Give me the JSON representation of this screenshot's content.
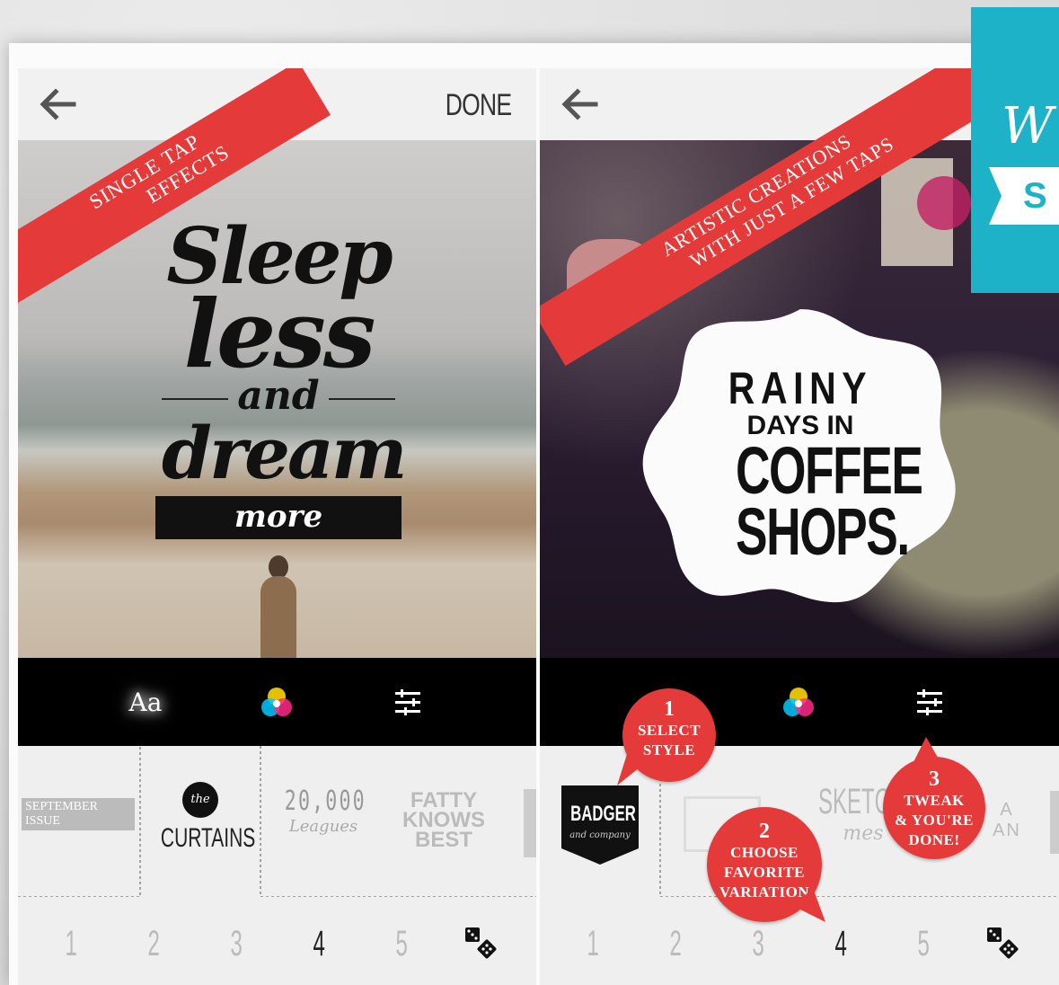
{
  "left_screen": {
    "back_icon": "arrow-left-icon",
    "done_label": "DONE",
    "ribbon_line1": "SINGLE TAP",
    "ribbon_line2": "EFFECTS",
    "quote": {
      "w1": "Sleep",
      "w2": "less",
      "w3": "and",
      "w4": "dream",
      "w5": "more"
    },
    "toolbar": {
      "text_tool": "Aa",
      "color_icon": "color-wheel-icon",
      "adjust_icon": "sliders-icon"
    },
    "styles": [
      {
        "line1": "SEPTEMBER",
        "line2": "ISSUE"
      },
      {
        "top": "the",
        "main": "CURTAINS"
      },
      {
        "main": "20,000",
        "sub": "Leagues"
      },
      {
        "line1": "FATTY",
        "line2": "KNOWS",
        "line3": "BEST"
      }
    ],
    "variations": [
      "1",
      "2",
      "3",
      "4",
      "5"
    ],
    "active_variation": "4",
    "random_icon": "dice-icon"
  },
  "right_screen": {
    "back_icon": "arrow-left-icon",
    "ribbon_line1": "ARTISTIC CREATIONS",
    "ribbon_line2": "WITH JUST A FEW TAPS",
    "sticker": {
      "l1": "RAINY",
      "l2": "DAYS IN",
      "l3": "COFFEE",
      "l4": "SHOPS."
    },
    "styles": [
      {
        "main": "BADGER",
        "sub": "and company"
      },
      {
        "main": "SKETCH",
        "sub": "mes"
      },
      {
        "main": "A",
        "sub": "AN"
      }
    ],
    "bubbles": [
      {
        "n": "1",
        "t1": "SELECT",
        "t2": "STYLE",
        "t3": ""
      },
      {
        "n": "2",
        "t1": "CHOOSE",
        "t2": "FAVORITE",
        "t3": "VARIATION"
      },
      {
        "n": "3",
        "t1": "TWEAK",
        "t2": "& YOU'RE",
        "t3": "DONE!"
      }
    ],
    "variations": [
      "1",
      "2",
      "3",
      "4",
      "5"
    ],
    "active_variation": "4",
    "random_icon": "dice-icon"
  },
  "teal_card": {
    "script": "W",
    "text": "S"
  },
  "colors": {
    "accent_red": "#e53a3a",
    "teal": "#1db2c8",
    "toolbar": "#000000"
  }
}
